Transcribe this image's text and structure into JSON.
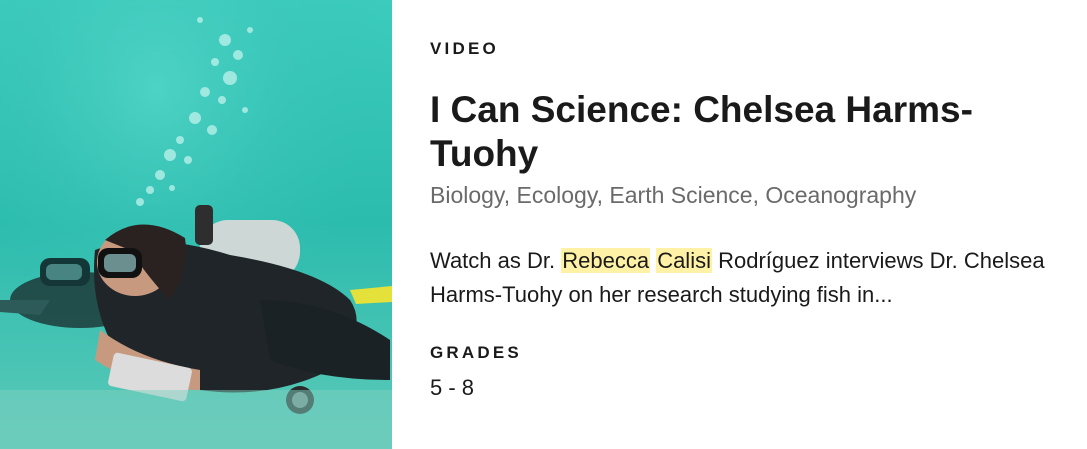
{
  "card": {
    "media_type": "VIDEO",
    "title": "I Can Science: Chelsea Harms-Tuohy",
    "subjects": "Biology, Ecology, Earth Science, Oceanography",
    "description": {
      "part1": "Watch as Dr. ",
      "highlight1": "Rebecca",
      "space": " ",
      "highlight2": "Calisi",
      "part2": " Rodríguez interviews Dr. Chelsea Harms-Tuohy on her research studying fish in..."
    },
    "grades_label": "GRADES",
    "grades_value": "5 - 8",
    "thumbnail_icon": "scuba-divers-photo"
  },
  "colors": {
    "water": "#2fbfb2",
    "highlight": "#fff2a6",
    "text": "#1a1a1a",
    "muted": "#6a6a6a"
  }
}
